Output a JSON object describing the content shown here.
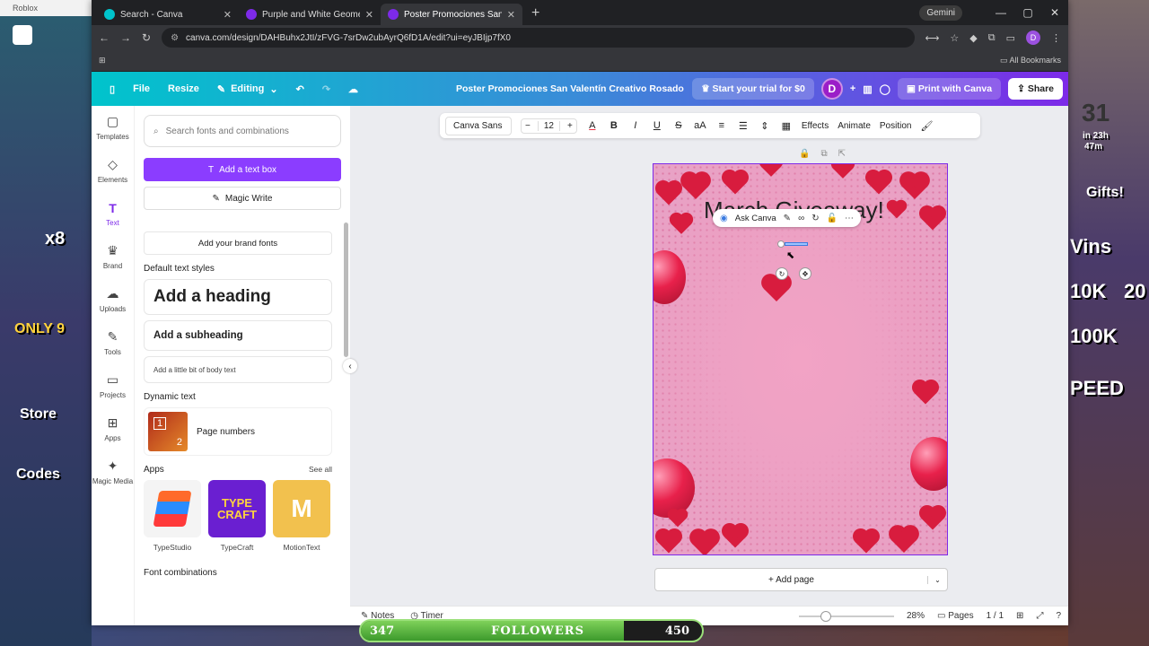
{
  "desktop": {
    "roblox_label": "Roblox",
    "left_texts": [
      "x8",
      "ONLY 9",
      "Store",
      "Codes"
    ],
    "right_texts": [
      "31",
      "in 23h",
      "47m",
      "Gifts!",
      "Vins",
      "10K",
      "100K",
      "PEED",
      "20"
    ]
  },
  "browser": {
    "tabs": [
      {
        "label": "Search - Canva",
        "active": false
      },
      {
        "label": "Purple and White Geometric Ba",
        "active": false
      },
      {
        "label": "Poster Promociones San Valentín",
        "active": true
      }
    ],
    "gemini": "Gemini",
    "url": "canva.com/design/DAHBuhx2JtI/zFVG-7srDw2ubAyrQ6fD1A/edit?ui=eyJBIjp7fX0",
    "profile_letter": "D",
    "all_bookmarks": "All Bookmarks"
  },
  "canva_header": {
    "file": "File",
    "resize": "Resize",
    "editing": "Editing",
    "title": "Poster Promociones San Valentín Creativo Rosado",
    "trial": "Start your trial for $0",
    "avatar": "D",
    "print": "Print with Canva",
    "share": "Share"
  },
  "rail": [
    {
      "label": "Templates",
      "icon": "templates-icon",
      "glyph": "▢"
    },
    {
      "label": "Elements",
      "icon": "elements-icon",
      "glyph": "◇"
    },
    {
      "label": "Text",
      "icon": "text-icon",
      "glyph": "T",
      "active": true
    },
    {
      "label": "Brand",
      "icon": "brand-icon",
      "glyph": "♛"
    },
    {
      "label": "Uploads",
      "icon": "uploads-icon",
      "glyph": "☁"
    },
    {
      "label": "Tools",
      "icon": "tools-icon",
      "glyph": "✎"
    },
    {
      "label": "Projects",
      "icon": "projects-icon",
      "glyph": "▭"
    },
    {
      "label": "Apps",
      "icon": "apps-icon",
      "glyph": "⊞"
    },
    {
      "label": "Magic Media",
      "icon": "magic-media-icon",
      "glyph": "✦"
    }
  ],
  "panel": {
    "search_placeholder": "Search fonts and combinations",
    "add_text_box": "Add a text box",
    "magic_write": "Magic Write",
    "brand_fonts": "Add your brand fonts",
    "default_styles": "Default text styles",
    "heading": "Add a heading",
    "subheading": "Add a subheading",
    "body": "Add a little bit of body text",
    "dynamic_text": "Dynamic text",
    "page_numbers": "Page numbers",
    "apps": "Apps",
    "see_all": "See all",
    "app_list": [
      {
        "name": "TypeStudio",
        "color": "#f4f4f4"
      },
      {
        "name": "TypeCraft",
        "color": "#6a1fd1"
      },
      {
        "name": "MotionText",
        "color": "#f2c14e"
      }
    ],
    "font_combinations": "Font combinations"
  },
  "toolbar": {
    "font": "Canva Sans",
    "minus": "−",
    "size": "12",
    "plus": "+",
    "effects": "Effects",
    "animate": "Animate",
    "position": "Position"
  },
  "poster": {
    "text": "March Giveaway!",
    "ask_canva": "Ask Canva"
  },
  "add_page": "+ Add page",
  "bottom": {
    "notes": "Notes",
    "timer": "Timer",
    "zoom": "28%",
    "zoom_fraction": 0.28,
    "pages": "Pages",
    "page_count": "1 / 1"
  },
  "followers": {
    "current": "347",
    "label": "FOLLOWERS",
    "goal": "450",
    "progress": 0.77
  }
}
